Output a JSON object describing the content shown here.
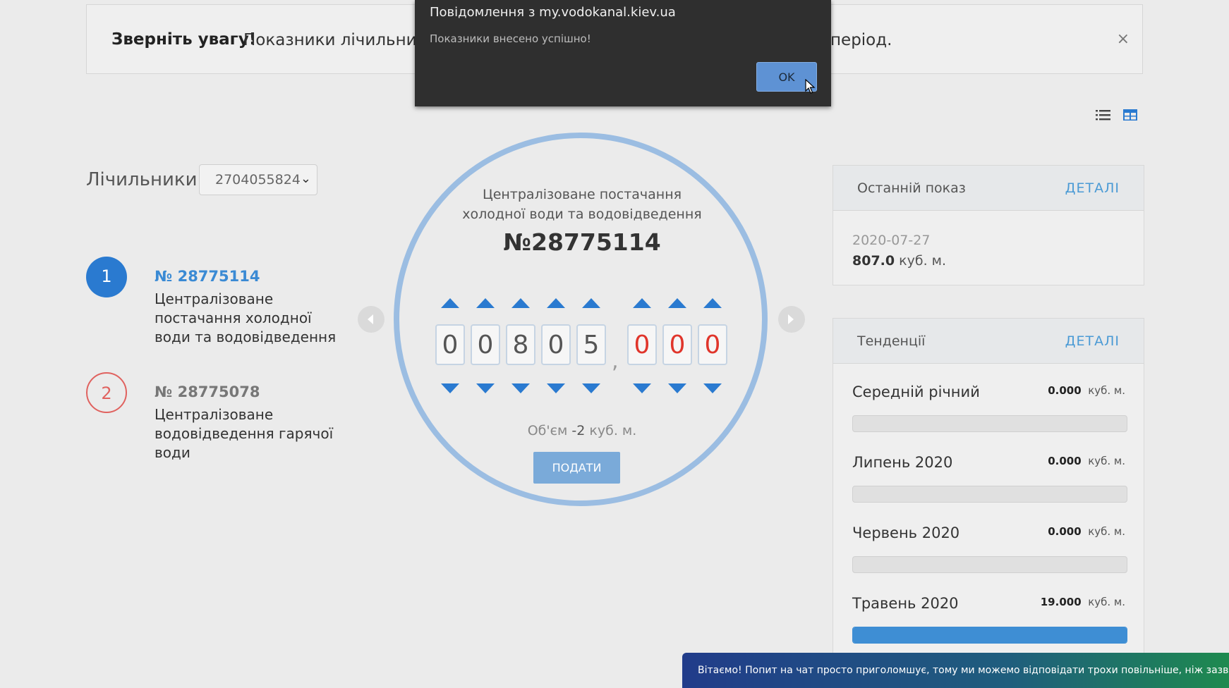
{
  "notice": {
    "bold": "Зверніть увагу!",
    "text": "Показники лічильник",
    "text_end": "період.",
    "close": "×"
  },
  "dialog": {
    "title": "Повідомлення з my.vodokanal.kiev.ua",
    "message": "Показники внесено успішно!",
    "ok": "OK"
  },
  "meters": {
    "label": "Лічильники",
    "selected_account": "2704055824",
    "items": [
      {
        "index": "1",
        "number": "№ 28775114",
        "desc": "Централізоване постачання холодної води та водовідведення",
        "state": "active"
      },
      {
        "index": "2",
        "number": "№ 28775078",
        "desc": "Централізоване водовідведення гарячої води",
        "state": "inactive"
      }
    ]
  },
  "meter_card": {
    "service_title": "Централізоване постачання холодної води та водовідведення",
    "meter_number": "№28775114",
    "digits_int": [
      "0",
      "0",
      "8",
      "0",
      "5"
    ],
    "comma": ",",
    "digits_frac": [
      "0",
      "0",
      "0"
    ],
    "volume_prefix": "Об'єм",
    "volume_value": "-2",
    "volume_unit": "куб. м.",
    "submit": "ПОДАТИ"
  },
  "last_reading": {
    "title": "Останній показ",
    "details": "ДЕТАЛІ",
    "date": "2020-07-27",
    "value": "807.0",
    "unit": "куб. м."
  },
  "trends": {
    "title": "Тенденції",
    "details": "ДЕТАЛІ",
    "unit": "куб. м.",
    "rows": [
      {
        "label": "Середній річний",
        "value": "0.000",
        "fill": 0
      },
      {
        "label": "Липень 2020",
        "value": "0.000",
        "fill": 0
      },
      {
        "label": "Червень 2020",
        "value": "0.000",
        "fill": 0
      },
      {
        "label": "Травень 2020",
        "value": "19.000",
        "fill": 1
      }
    ]
  },
  "chat_toast": "Вітаємо! Попит на чат просто приголомшує, тому ми можемо відповідати трохи повільніше, ніж зазвичай",
  "colors": {
    "accent": "#2a7ad0",
    "ring": "#9bbde2",
    "link": "#4a9ad5",
    "alert": "#e0352b"
  }
}
